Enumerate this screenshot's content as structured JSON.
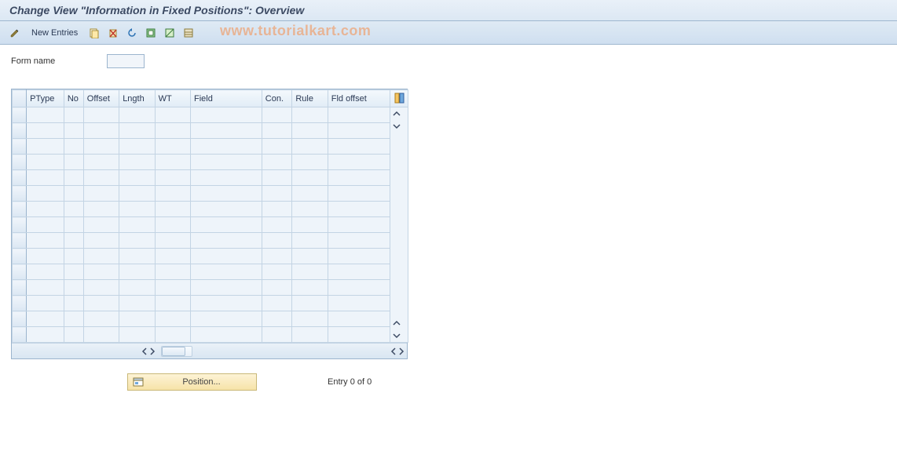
{
  "title": "Change View \"Information in Fixed Positions\": Overview",
  "toolbar": {
    "new_entries_label": "New Entries"
  },
  "watermark": "www.tutorialkart.com",
  "form": {
    "form_name_label": "Form name",
    "form_name_value": ""
  },
  "table": {
    "columns": {
      "ptype": "PType",
      "no": "No",
      "offset": "Offset",
      "lngth": "Lngth",
      "wt": "WT",
      "field": "Field",
      "con": "Con.",
      "rule": "Rule",
      "fld_offset": "Fld offset"
    },
    "rows": [
      {},
      {},
      {},
      {},
      {},
      {},
      {},
      {},
      {},
      {},
      {},
      {},
      {},
      {},
      {}
    ]
  },
  "footer": {
    "position_label": "Position...",
    "entry_text": "Entry 0 of 0"
  }
}
